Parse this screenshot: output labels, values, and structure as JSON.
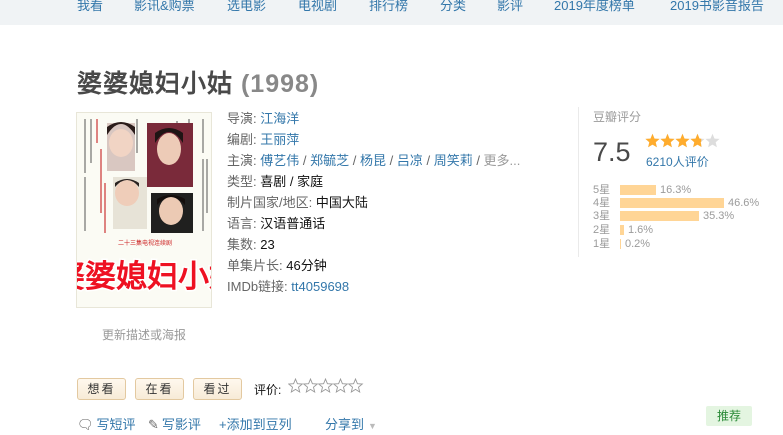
{
  "nav": {
    "items": [
      "我看",
      "影讯&购票",
      "选电影",
      "电视剧",
      "排行榜",
      "分类",
      "影评",
      "2019年度榜单",
      "2019书影音报告"
    ]
  },
  "movie": {
    "title": "婆婆媳妇小姑",
    "year": "(1998)",
    "poster_text": "婆婆媳妇小姑",
    "poster_caption": "二十三集电视连续剧",
    "update_link": "更新描述或海报"
  },
  "info": {
    "director_label": "导演:",
    "director": "江海洋",
    "writer_label": "编剧:",
    "writer": "王丽萍",
    "cast_label": "主演:",
    "cast": [
      "傅艺伟",
      "郑毓芝",
      "杨昆",
      "吕凉",
      "周笑莉"
    ],
    "cast_sep": " / ",
    "cast_more": "更多...",
    "genre_label": "类型:",
    "genre": "喜剧 / 家庭",
    "region_label": "制片国家/地区:",
    "region": "中国大陆",
    "language_label": "语言:",
    "language": "汉语普通话",
    "episodes_label": "集数:",
    "episodes": "23",
    "runtime_label": "单集片长:",
    "runtime": "46分钟",
    "imdb_label": "IMDb链接:",
    "imdb": "tt4059698"
  },
  "rating": {
    "label": "豆瓣评分",
    "score": "7.5",
    "star_fill": 0.75,
    "votes": "6210人评价",
    "distribution": [
      {
        "label": "5星",
        "percent": 16.3,
        "text": "16.3%"
      },
      {
        "label": "4星",
        "percent": 46.6,
        "text": "46.6%"
      },
      {
        "label": "3星",
        "percent": 35.3,
        "text": "35.3%"
      },
      {
        "label": "2星",
        "percent": 1.6,
        "text": "1.6%"
      },
      {
        "label": "1星",
        "percent": 0.2,
        "text": "0.2%"
      }
    ]
  },
  "interest": {
    "want": "想看",
    "watching": "在看",
    "watched": "看过",
    "rate_label": "评价:"
  },
  "actions": {
    "short_review": "写短评",
    "review": "写影评",
    "add_doulist": "+添加到豆列",
    "share": "分享到",
    "recommend": "推荐"
  },
  "colors": {
    "link": "#3377aa",
    "star": "#ffac2d",
    "bar": "#ffd596",
    "nav_bg": "#f0f3f5"
  }
}
